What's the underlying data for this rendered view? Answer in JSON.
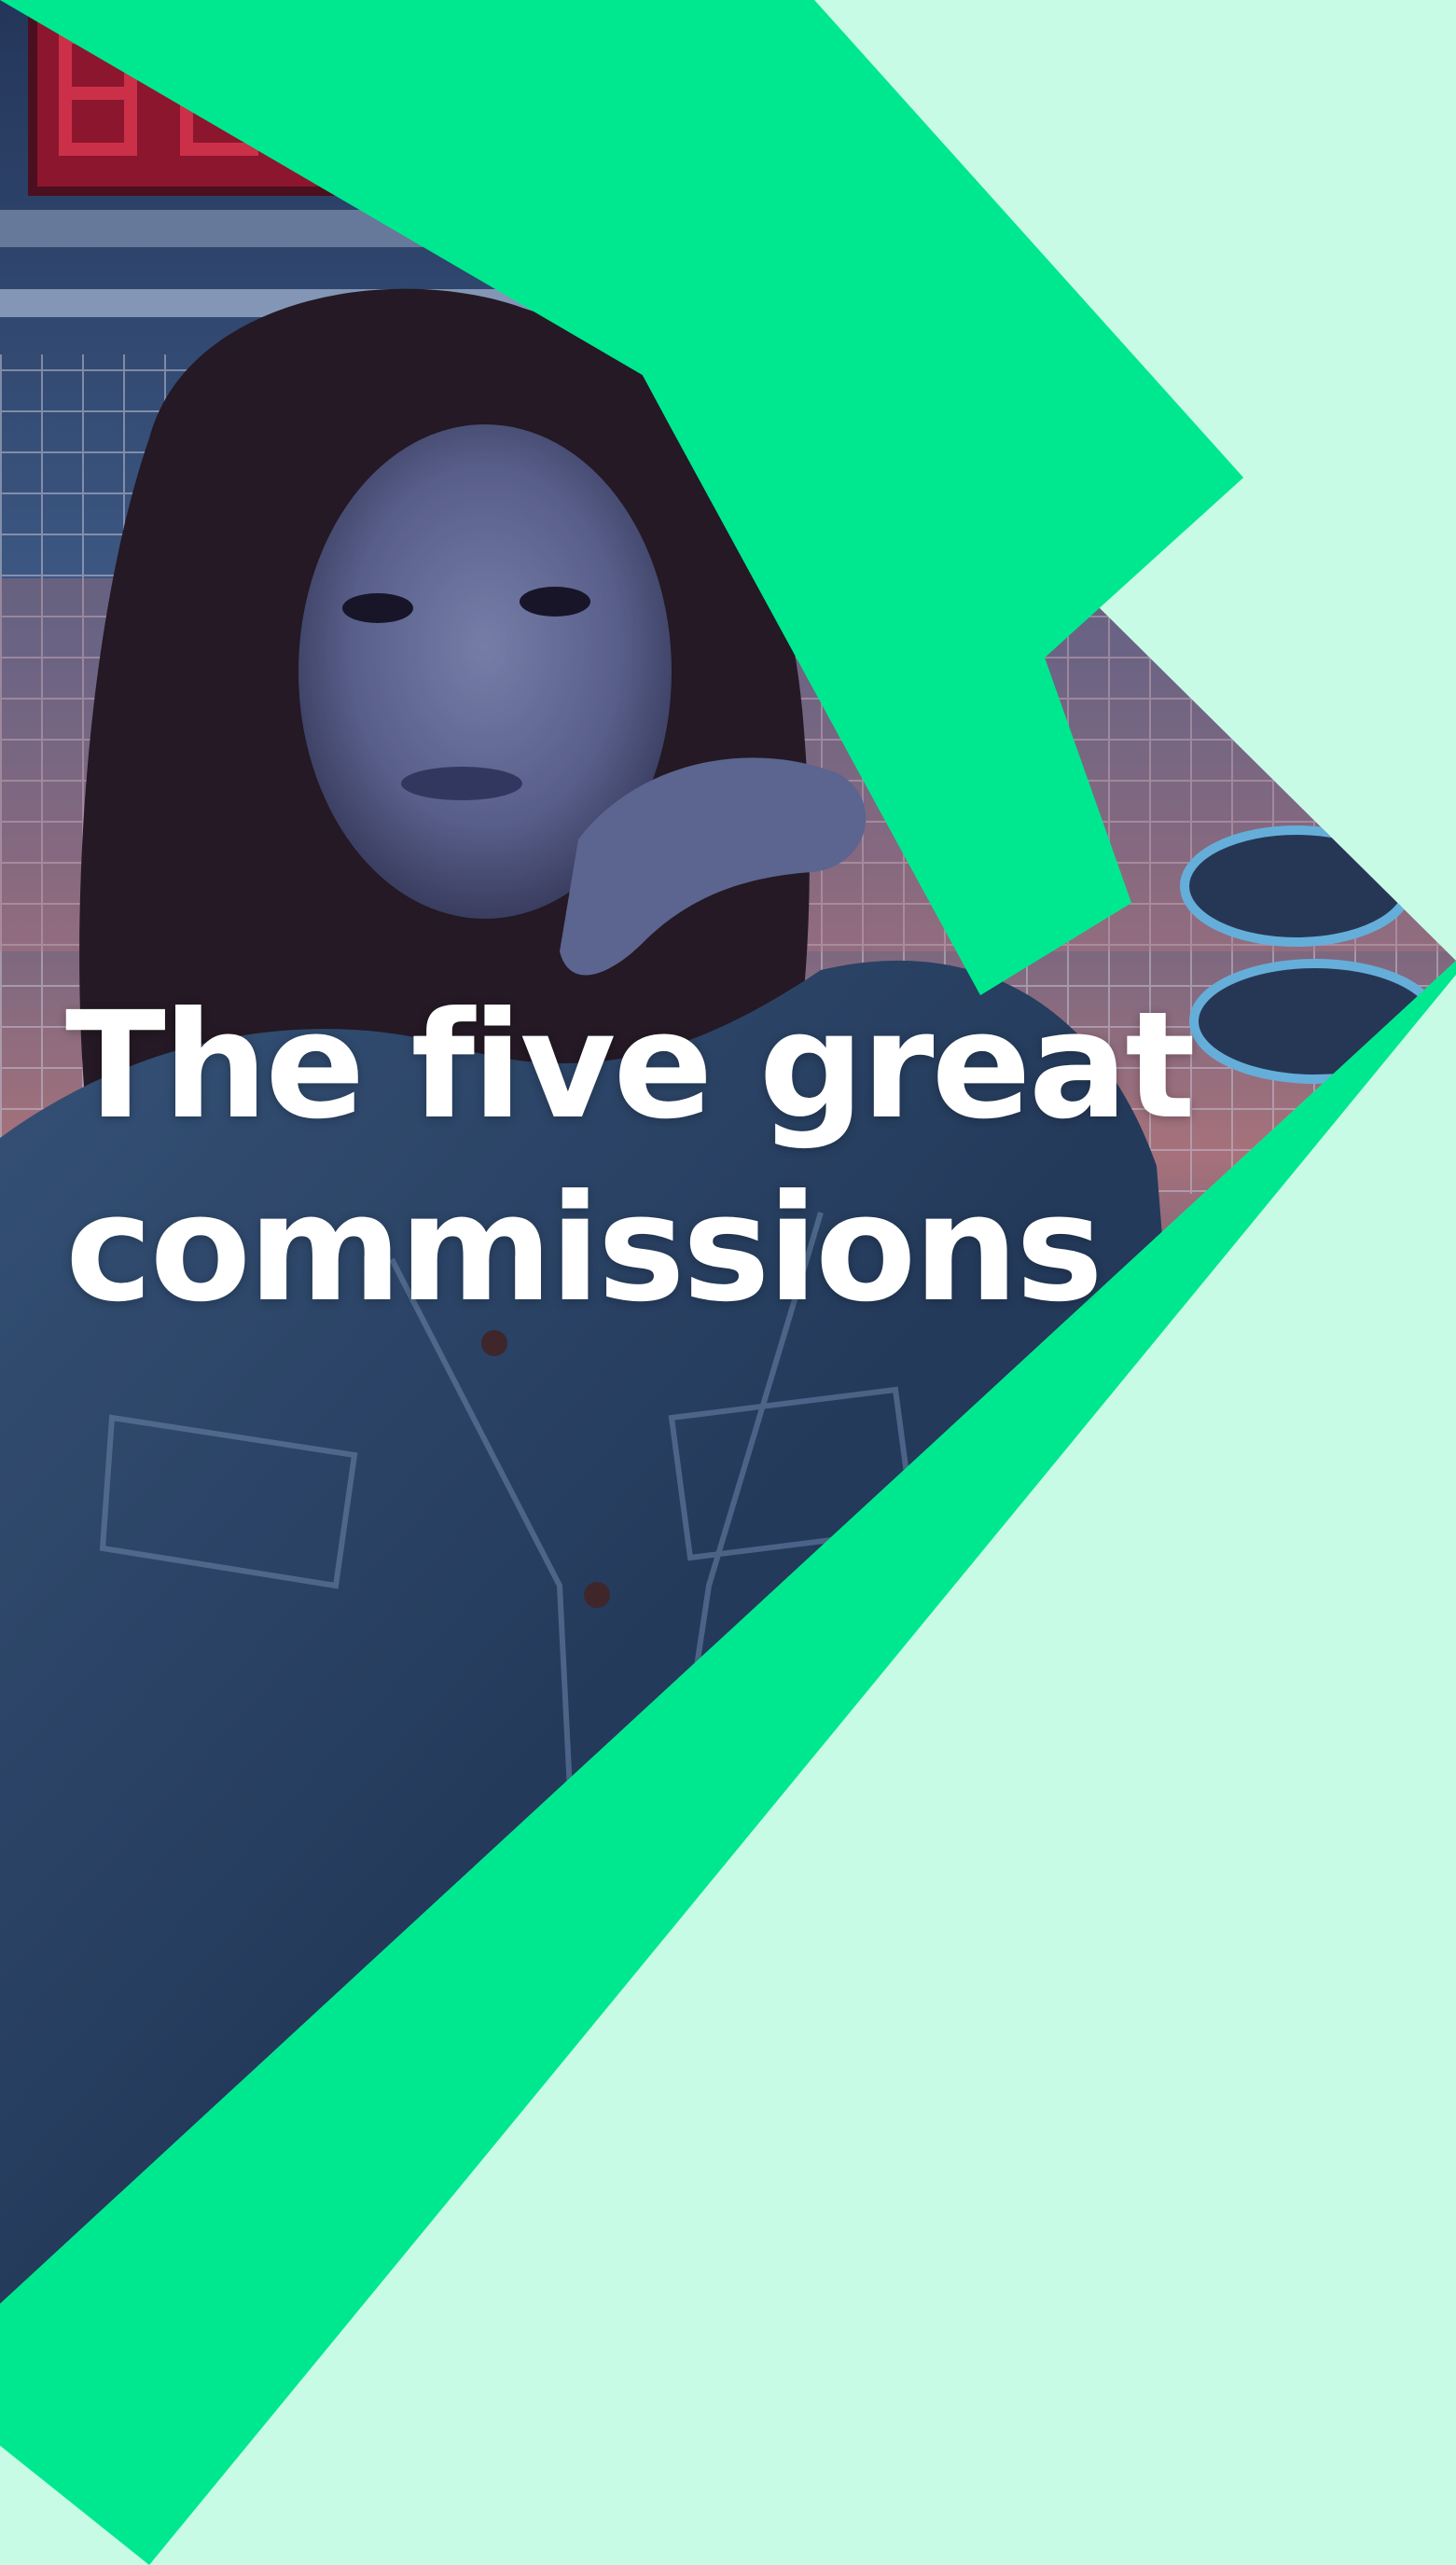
{
  "headline": {
    "line1": "The five great",
    "line2": "commissions"
  },
  "colors": {
    "background": "#c8fbe6",
    "accent": "#00e88f",
    "text": "#ffffff"
  }
}
